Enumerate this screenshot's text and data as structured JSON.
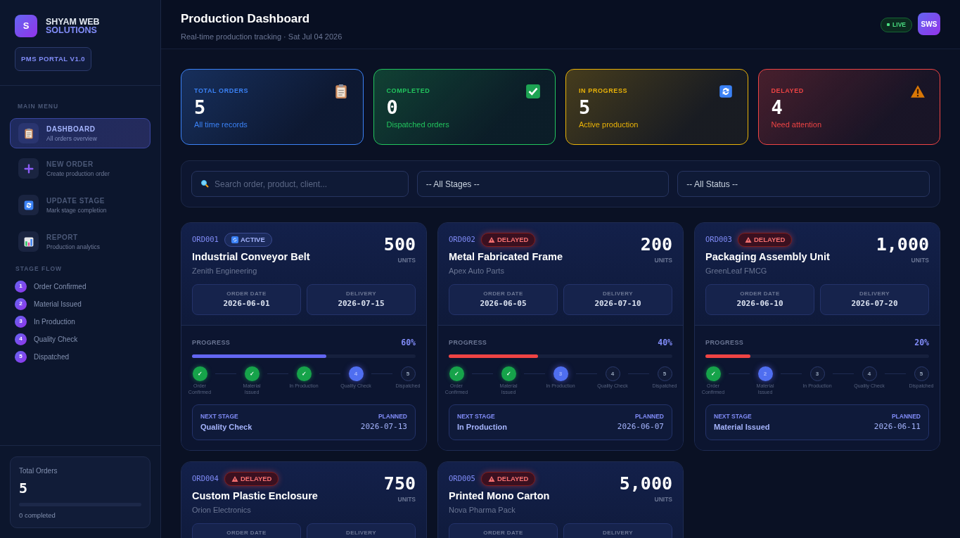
{
  "sidebar": {
    "brand": {
      "logo": "S",
      "line1": "SHYAM WEB",
      "line2": "SOLUTIONS"
    },
    "version": "PMS PORTAL V1.0",
    "menu_heading": "MAIN MENU",
    "items": [
      {
        "kind": "clipboard",
        "label": "DASHBOARD",
        "sub": "All orders overview",
        "selected": true
      },
      {
        "kind": "plus",
        "label": "NEW ORDER",
        "sub": "Create production order",
        "selected": false
      },
      {
        "kind": "refresh",
        "label": "UPDATE STAGE",
        "sub": "Mark stage completion",
        "selected": false
      },
      {
        "kind": "chart",
        "label": "REPORT",
        "sub": "Production analytics",
        "selected": false
      }
    ],
    "flow_heading": "STAGE FLOW",
    "flow": [
      {
        "num": "1",
        "label": "Order Confirmed"
      },
      {
        "num": "2",
        "label": "Material Issued"
      },
      {
        "num": "3",
        "label": "In Production"
      },
      {
        "num": "4",
        "label": "Quality Check"
      },
      {
        "num": "5",
        "label": "Dispatched"
      }
    ],
    "summary": {
      "label": "Total Orders",
      "value": "5",
      "level": 0,
      "note": "0 completed"
    }
  },
  "header": {
    "title": "Production Dashboard",
    "subtitle": "Real-time production tracking · Sat Jul 04 2026",
    "live": "LIVE",
    "avatar": "SWS"
  },
  "stats": [
    {
      "kind": "clipboard",
      "color": "#3b82f6",
      "label": "TOTAL ORDERS",
      "value": "5",
      "note": "All time records"
    },
    {
      "kind": "check",
      "color": "#22c55e",
      "label": "COMPLETED",
      "value": "0",
      "note": "Dispatched orders"
    },
    {
      "kind": "refresh",
      "color": "#eab308",
      "label": "IN PROGRESS",
      "value": "5",
      "note": "Active production"
    },
    {
      "kind": "warning",
      "color": "#ef4444",
      "label": "DELAYED",
      "value": "4",
      "note": "Need attention"
    }
  ],
  "filters": {
    "search": {
      "placeholder": "Search order, product, client..."
    },
    "stage": "-- All Stages --",
    "status": "-- All Status --"
  },
  "orders": [
    {
      "id": "ORD001",
      "kind": "active",
      "badge": "ACTIVE",
      "name": "Industrial Conveyor Belt",
      "client": "Zenith Engineering",
      "units": "500",
      "units_label": "UNITS",
      "dates": [
        {
          "label": "ORDER DATE",
          "value": "2026-06-01"
        },
        {
          "label": "DELIVERY",
          "value": "2026-07-15"
        }
      ],
      "progress": {
        "label": "PROGRESS",
        "reading": "60%",
        "level": 0.6
      },
      "stages": [
        {
          "kind": "done",
          "mark": "✓",
          "label": "Order Confirmed"
        },
        {
          "kind": "done",
          "mark": "✓",
          "label": "Material Issued"
        },
        {
          "kind": "done",
          "mark": "✓",
          "label": "In Production"
        },
        {
          "kind": "current",
          "mark": "4",
          "label": "Quality Check"
        },
        {
          "kind": "pending",
          "mark": "5",
          "label": "Dispatched"
        }
      ],
      "next": {
        "label": "NEXT STAGE",
        "value": "Quality Check",
        "planned_label": "PLANNED",
        "planned": "2026-07-13"
      }
    },
    {
      "id": "ORD002",
      "kind": "delayed",
      "badge": "DELAYED",
      "name": "Metal Fabricated Frame",
      "client": "Apex Auto Parts",
      "units": "200",
      "units_label": "UNITS",
      "dates": [
        {
          "label": "ORDER DATE",
          "value": "2026-06-05"
        },
        {
          "label": "DELIVERY",
          "value": "2026-07-10"
        }
      ],
      "progress": {
        "label": "PROGRESS",
        "reading": "40%",
        "level": 0.4
      },
      "stages": [
        {
          "kind": "done",
          "mark": "✓",
          "label": "Order Confirmed"
        },
        {
          "kind": "done",
          "mark": "✓",
          "label": "Material Issued"
        },
        {
          "kind": "current",
          "mark": "3",
          "label": "In Production"
        },
        {
          "kind": "pending",
          "mark": "4",
          "label": "Quality Check"
        },
        {
          "kind": "pending",
          "mark": "5",
          "label": "Dispatched"
        }
      ],
      "next": {
        "label": "NEXT STAGE",
        "value": "In Production",
        "planned_label": "PLANNED",
        "planned": "2026-06-07"
      }
    },
    {
      "id": "ORD003",
      "kind": "delayed",
      "badge": "DELAYED",
      "name": "Packaging Assembly Unit",
      "client": "GreenLeaf FMCG",
      "units": "1,000",
      "units_label": "UNITS",
      "dates": [
        {
          "label": "ORDER DATE",
          "value": "2026-06-10"
        },
        {
          "label": "DELIVERY",
          "value": "2026-07-20"
        }
      ],
      "progress": {
        "label": "PROGRESS",
        "reading": "20%",
        "level": 0.2
      },
      "stages": [
        {
          "kind": "done",
          "mark": "✓",
          "label": "Order Confirmed"
        },
        {
          "kind": "current",
          "mark": "2",
          "label": "Material Issued"
        },
        {
          "kind": "pending",
          "mark": "3",
          "label": "In Production"
        },
        {
          "kind": "pending",
          "mark": "4",
          "label": "Quality Check"
        },
        {
          "kind": "pending",
          "mark": "5",
          "label": "Dispatched"
        }
      ],
      "next": {
        "label": "NEXT STAGE",
        "value": "Material Issued",
        "planned_label": "PLANNED",
        "planned": "2026-06-11"
      }
    },
    {
      "id": "ORD004",
      "kind": "delayed",
      "badge": "DELAYED",
      "name": "Custom Plastic Enclosure",
      "client": "Orion Electronics",
      "units": "750",
      "units_label": "UNITS",
      "dates": [
        {
          "label": "ORDER DATE"
        },
        {
          "label": "DELIVERY"
        }
      ]
    },
    {
      "id": "ORD005",
      "kind": "delayed",
      "badge": "DELAYED",
      "name": "Printed Mono Carton",
      "client": "Nova Pharma Pack",
      "units": "5,000",
      "units_label": "UNITS",
      "dates": [
        {
          "label": "ORDER DATE"
        },
        {
          "label": "DELIVERY"
        }
      ]
    }
  ]
}
